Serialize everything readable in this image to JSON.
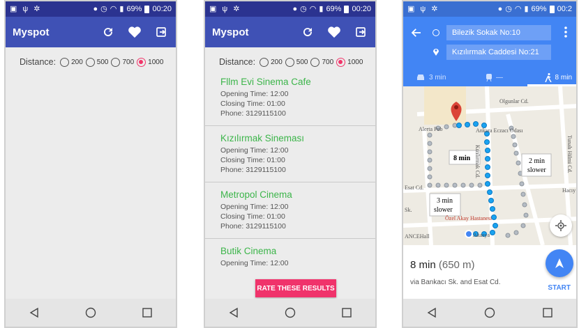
{
  "statusbar": {
    "battery_full": "69%",
    "time_full": "00:20",
    "battery_cut": "69%",
    "time_cut": "00:2"
  },
  "app": {
    "title": "Myspot"
  },
  "distance": {
    "label": "Distance:",
    "options": [
      "200",
      "500",
      "700",
      "1000"
    ],
    "selected": "1000"
  },
  "results": [
    {
      "name": "Fllm Evi Sinema Cafe",
      "opening": "Opening Time: 12:00",
      "closing": "Closing Time: 01:00",
      "phone": "Phone: 3129115100"
    },
    {
      "name": "Kızılırmak Sineması",
      "opening": "Opening Time: 12:00",
      "closing": "Closing Time: 01:00",
      "phone": "Phone: 3129115100"
    },
    {
      "name": "Metropol Cinema",
      "opening": "Opening Time: 12:00",
      "closing": "Closing Time: 01:00",
      "phone": "Phone: 3129115100"
    },
    {
      "name": "Butik Cinema",
      "opening": "Opening Time: 12:00"
    }
  ],
  "rate_button": "RATE THESE RESULTS",
  "maps": {
    "from": "Bilezik Sokak No:10",
    "to": "Kızılırmak Caddesi No:21",
    "mode_car": "3 min",
    "mode_transit": "—",
    "mode_walk": "8 min",
    "map_labels": {
      "route_time": "8 min",
      "alt1_time": "2 min",
      "alt1_note": "slower",
      "alt2_time": "3 min",
      "alt2_note": "slower",
      "poi_pub": "Alerta Pub",
      "poi_pharmacy": "Ankara Eczacı Odası",
      "poi_hospital": "Özel Akay Hastanesi",
      "poi_hall": "ANCEHall",
      "poi_bottom": "Akasya",
      "street_top": "Olgunlar Cd.",
      "street_mid": "Kızılırmak Cd.",
      "street_left": "Esat Cd.",
      "street_far_left": "Sk.",
      "street_right": "Tunalı Hilmi Cd.",
      "street_right2": "Hacıy"
    },
    "summary_time": "8 min",
    "summary_distance": "(650 m)",
    "via": "via Bankacı Sk. and Esat Cd.",
    "start": "START"
  },
  "colors": {
    "primary": "#3f51b5",
    "accent": "#f0366a",
    "green": "#3cb54a",
    "maps_blue": "#4285f4"
  }
}
